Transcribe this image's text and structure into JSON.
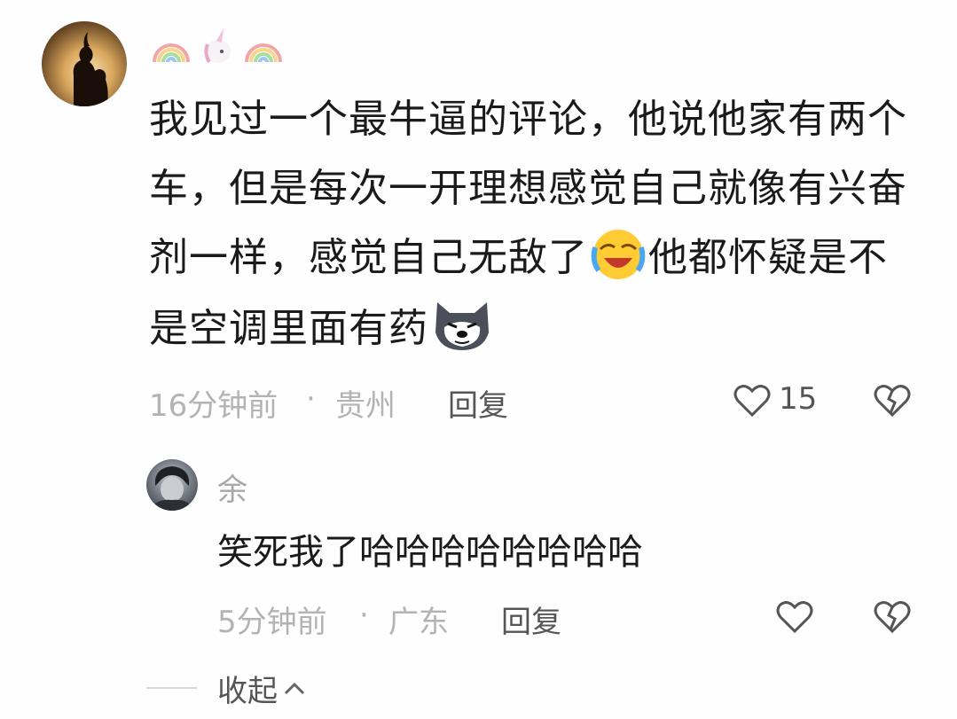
{
  "comment": {
    "username_emojis": [
      "rainbow-icon",
      "unicorn-icon",
      "rainbow-icon"
    ],
    "text_parts": [
      "我见过一个最牛逼的评论，他说他家有两个车，但是每次一开理想感觉自己就像有兴奋剂一样，感觉自己无敌了",
      "他都怀疑是不是空调里面有药"
    ],
    "inline_emojis": [
      "laughing-crying-icon",
      "smug-dog-icon"
    ],
    "time": "16分钟前",
    "separator": "·",
    "location": "贵州",
    "reply_label": "回复",
    "like_count": "15"
  },
  "reply": {
    "username": "余",
    "text": "笑死我了哈哈哈哈哈哈哈哈",
    "time": "5分钟前",
    "separator": "·",
    "location": "广东",
    "reply_label": "回复"
  },
  "collapse_label": "收起"
}
